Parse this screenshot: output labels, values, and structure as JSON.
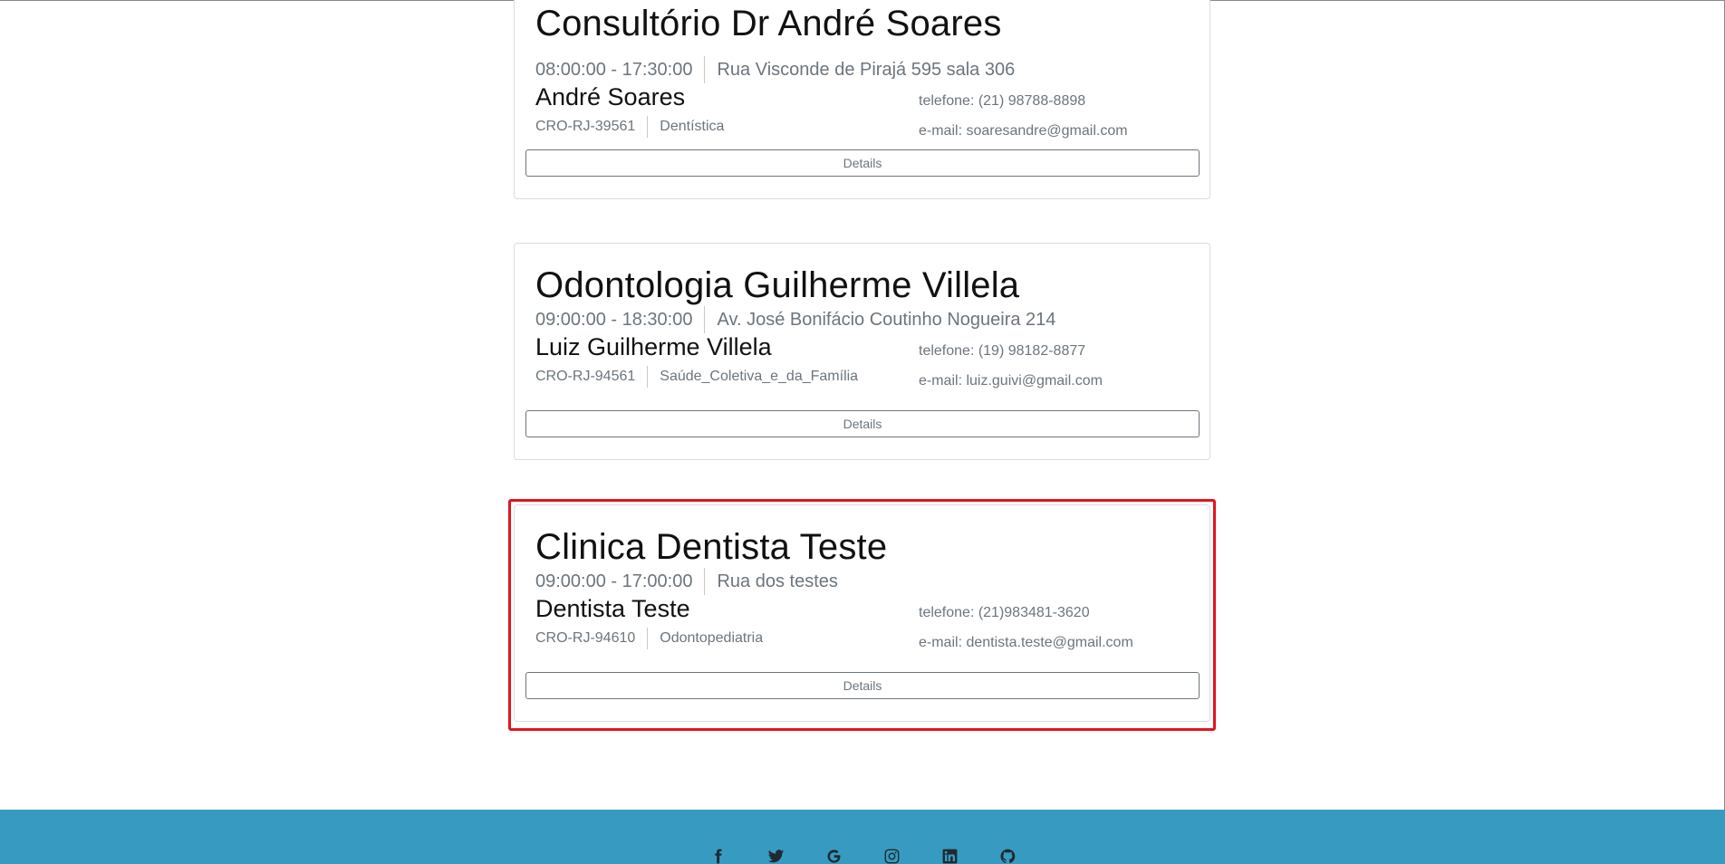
{
  "clinics": [
    {
      "name": "Consultório Dr André Soares",
      "hours": "08:00:00 - 17:30:00",
      "address": "Rua Visconde de Pirajá 595 sala 306",
      "dentist": "André Soares",
      "cro": "CRO-RJ-39561",
      "specialty": "Dentística",
      "phone": "telefone: (21) 98788-8898",
      "email": "e-mail: soaresandre@gmail.com",
      "details_label": "Details"
    },
    {
      "name": "Odontologia Guilherme Villela",
      "hours": "09:00:00 - 18:30:00",
      "address": "Av. José Bonifácio Coutinho Nogueira 214",
      "dentist": "Luiz Guilherme Villela",
      "cro": "CRO-RJ-94561",
      "specialty": "Saúde_Coletiva_e_da_Família",
      "phone": "telefone: (19) 98182-8877",
      "email": "e-mail: luiz.guivi@gmail.com",
      "details_label": "Details"
    },
    {
      "name": "Clinica Dentista Teste",
      "hours": "09:00:00 - 17:00:00",
      "address": "Rua dos testes",
      "dentist": "Dentista Teste",
      "cro": "CRO-RJ-94610",
      "specialty": "Odontopediatria",
      "phone": "telefone: (21)983481-3620",
      "email": "e-mail: dentista.teste@gmail.com",
      "details_label": "Details"
    }
  ],
  "highlighted_card": "Clinica Dentista Teste",
  "footer": {
    "background_color": "#379bc1",
    "social_icons": [
      "facebook-icon",
      "twitter-icon",
      "google-icon",
      "instagram-icon",
      "linkedin-icon",
      "github-icon"
    ]
  },
  "colors": {
    "highlight_border": "#e4141d",
    "muted_text": "#6c757d"
  }
}
